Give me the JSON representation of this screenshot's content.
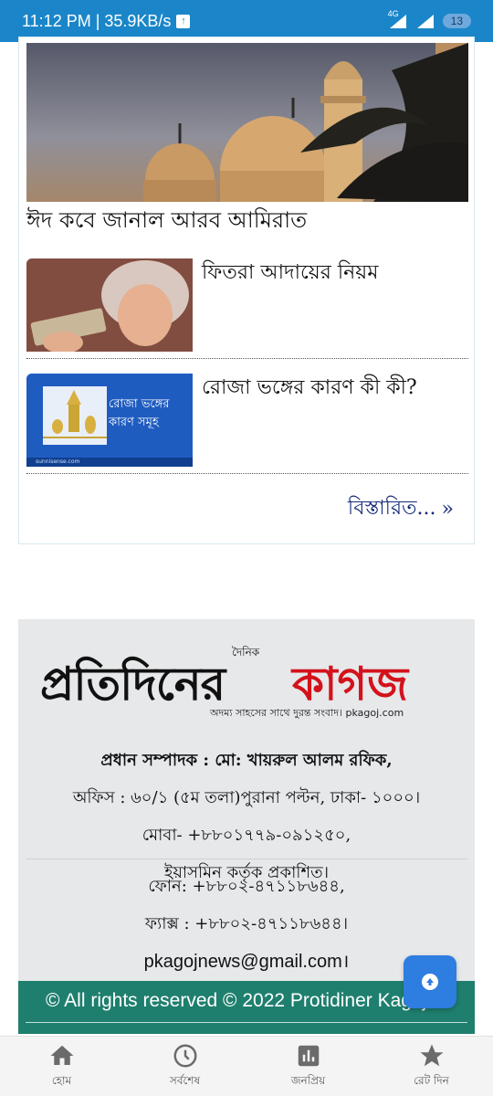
{
  "status_bar": {
    "time_speed": "11:12 PM | 35.9KB/s",
    "network": "4G",
    "battery": "13"
  },
  "news": {
    "hero_title": "ঈদ কবে জানাল আরব আমিরাত",
    "items": [
      {
        "title": "ফিতরা আদায়ের নিয়ম"
      },
      {
        "title": "রোজা ভঙ্গের কারণ কী কী?",
        "thumb_text_1": "রোজা ভঙ্গের",
        "thumb_text_2": "কারণ সমূহ",
        "thumb_source": "sunnisense.com"
      }
    ],
    "more_label": "বিস্তারিত...",
    "more_arrow": "»"
  },
  "footer": {
    "logo_main": "প্রতিদিনের",
    "logo_red": "কাগজ",
    "logo_small": "দৈনিক",
    "logo_tagline": "অদম্য সাহসের সাথে দুরন্ত সংবাদ। pkagoj.com",
    "editor": "প্রধান সম্পাদক : মো: খায়রুল আলম রফিক,",
    "office": "অফিস : ৬০/১ (৫ম তলা)পুরানা পল্টন, ঢাকা- ১০০০।",
    "mobile": "মোবা- +৮৮০১৭৭৯-০৯১২৫০,",
    "publisher": "ইয়াসমিন কর্তৃক প্রকাশিত।",
    "phone": "ফোন: +৮৮০২-৪৭১১৮৬৪৪,",
    "fax": "ফ্যাক্স : +৮৮০২-৪৭১১৮৬৪৪।",
    "email": "pkagojnews@gmail.com।",
    "copyright": "© All rights reserved © 2022 Protidiner Kagoj"
  },
  "bottom_nav": {
    "items": [
      {
        "label": "হোম",
        "icon": "home-icon"
      },
      {
        "label": "সর্বশেষ",
        "icon": "clock-icon"
      },
      {
        "label": "জনপ্রিয়",
        "icon": "chart-icon"
      },
      {
        "label": "রেট দিন",
        "icon": "star-icon"
      }
    ]
  },
  "colors": {
    "status_bar": "#1a86c9",
    "logo_red": "#d3121b",
    "footer_bg": "#e6e8ea",
    "copyright_bg": "#1f7f6e",
    "fab": "#2e7de0"
  }
}
